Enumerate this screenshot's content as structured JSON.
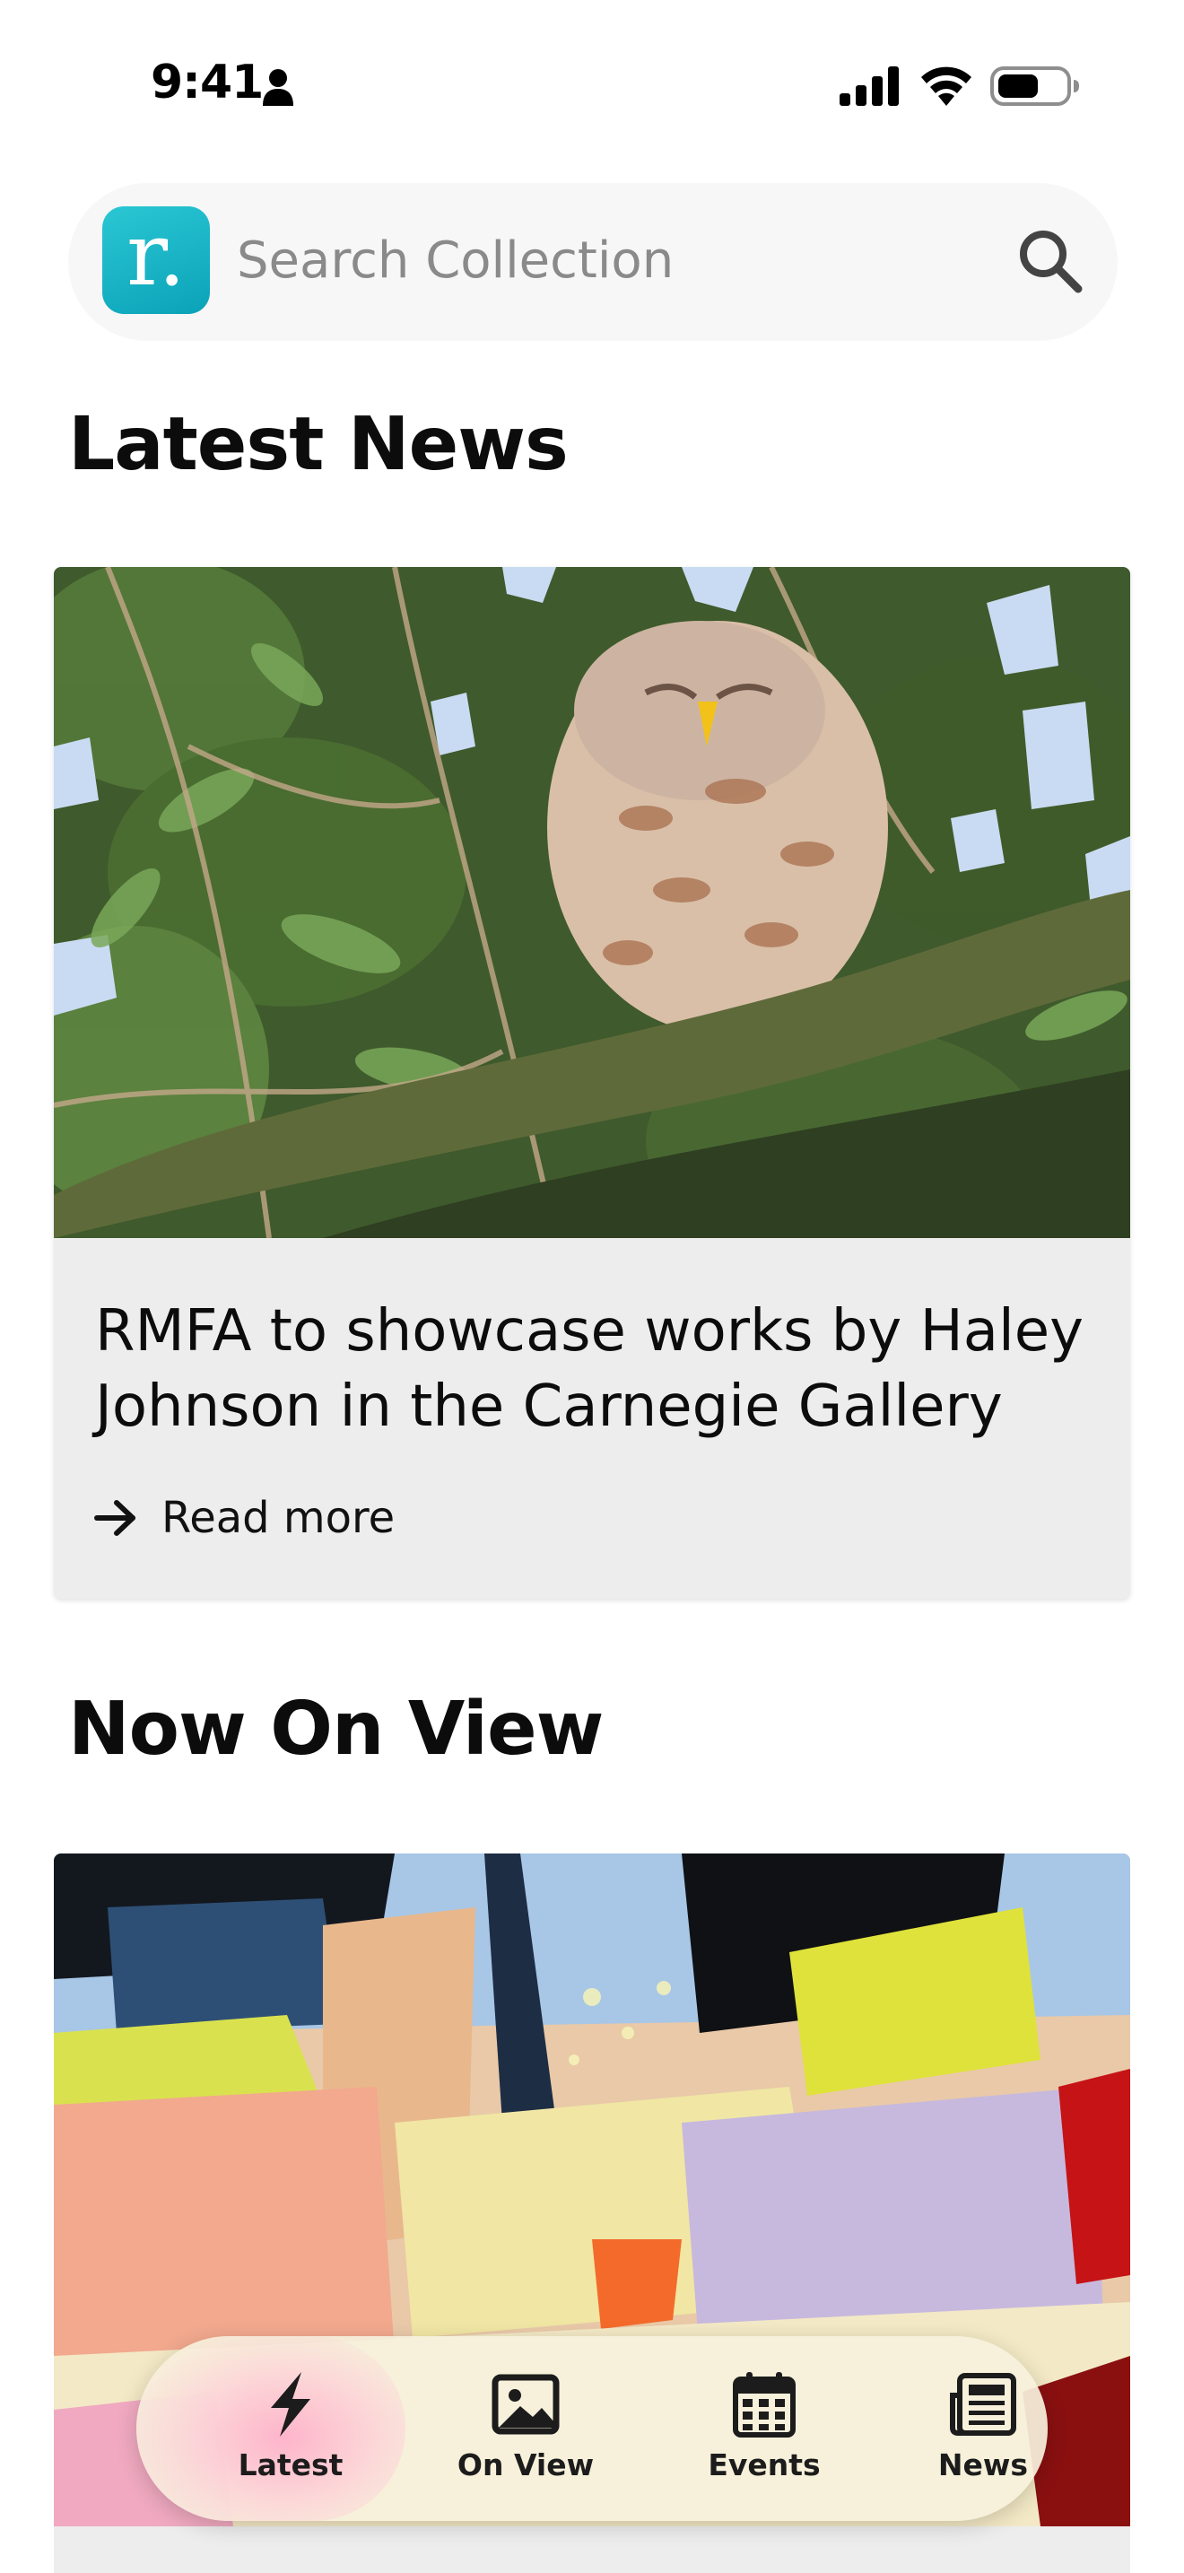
{
  "status_bar": {
    "time": "9:41"
  },
  "search": {
    "logo_letter": "r.",
    "placeholder": "Search Collection"
  },
  "latest_news": {
    "heading": "Latest News",
    "headline": "RMFA to showcase works by Haley Johnson in the Carnegie Gallery",
    "read_more": "Read more"
  },
  "now_on_view": {
    "heading": "Now On View"
  },
  "tab_bar": {
    "tabs": [
      {
        "label": "Latest",
        "icon": "lightning-icon",
        "selected": true
      },
      {
        "label": "On View",
        "icon": "image-icon",
        "selected": false
      },
      {
        "label": "Events",
        "icon": "calendar-icon",
        "selected": false
      },
      {
        "label": "News",
        "icon": "newspaper-icon",
        "selected": false
      }
    ]
  },
  "colors": {
    "logo_teal": "#13b2c4",
    "card_background": "#ededed",
    "tab_bar_background": "#f6f0dc"
  }
}
